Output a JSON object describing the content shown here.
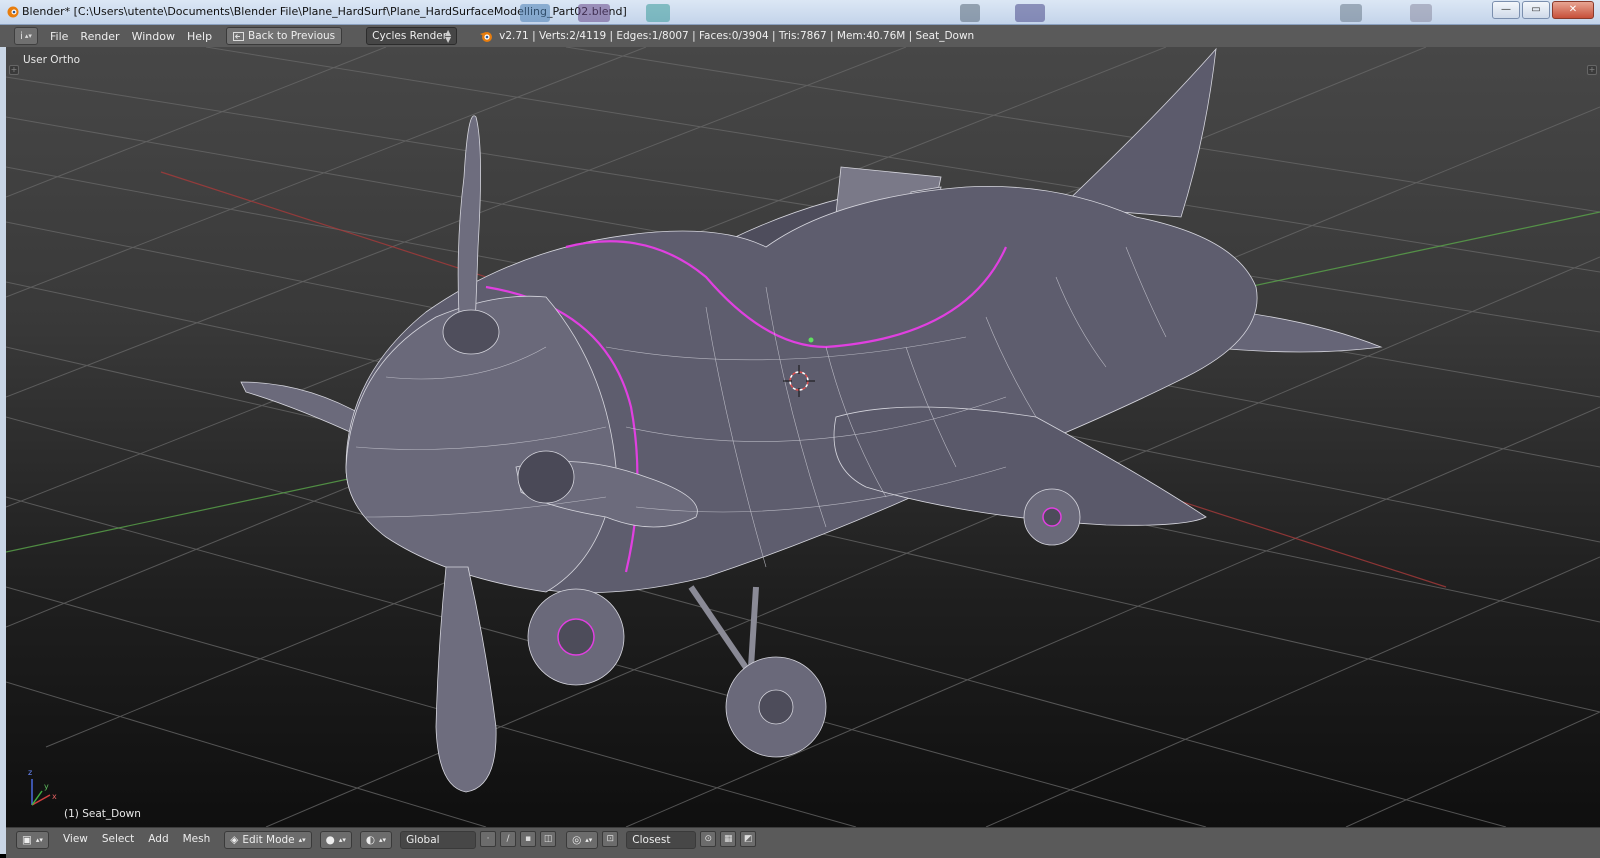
{
  "window": {
    "title": "Blender* [C:\\Users\\utente\\Documents\\Blender File\\Plane_HardSurf\\Plane_HardSurfaceModelling_Part02.blend]",
    "minimize": "—",
    "maximize": "▭",
    "close": "✕"
  },
  "header": {
    "editor_icon": "i",
    "menu": [
      "File",
      "Render",
      "Window",
      "Help"
    ],
    "back_button": "Back to Previous",
    "render_engine": "Cycles Render",
    "stats": "v2.71 | Verts:2/4119 | Edges:1/8007 | Faces:0/3904 | Tris:7867 | Mem:40.76M | Seat_Down"
  },
  "viewport": {
    "view_name": "User Ortho",
    "object_info": "(1) Seat_Down",
    "axis_labels": [
      "x",
      "y",
      "z"
    ]
  },
  "footer": {
    "menu": [
      "View",
      "Select",
      "Add",
      "Mesh"
    ],
    "mode": "Edit Mode",
    "orientation": "Global",
    "snap_target": "Closest"
  },
  "icons": {
    "app": "blender-icon",
    "editor_type": "info-icon",
    "back": "back-arrow-icon",
    "engine_arrows": "up-down-arrows-icon",
    "3d_cursor": "cursor-3d-icon"
  },
  "colors": {
    "header_bg": "#5a5a5a",
    "selected_edge": "#e040e0",
    "mesh_surface": "#5e5d6e",
    "wire": "#d6d6de",
    "grid": "#6a6a6a",
    "x_axis": "#a83a3a",
    "y_axis": "#5aa64a"
  }
}
